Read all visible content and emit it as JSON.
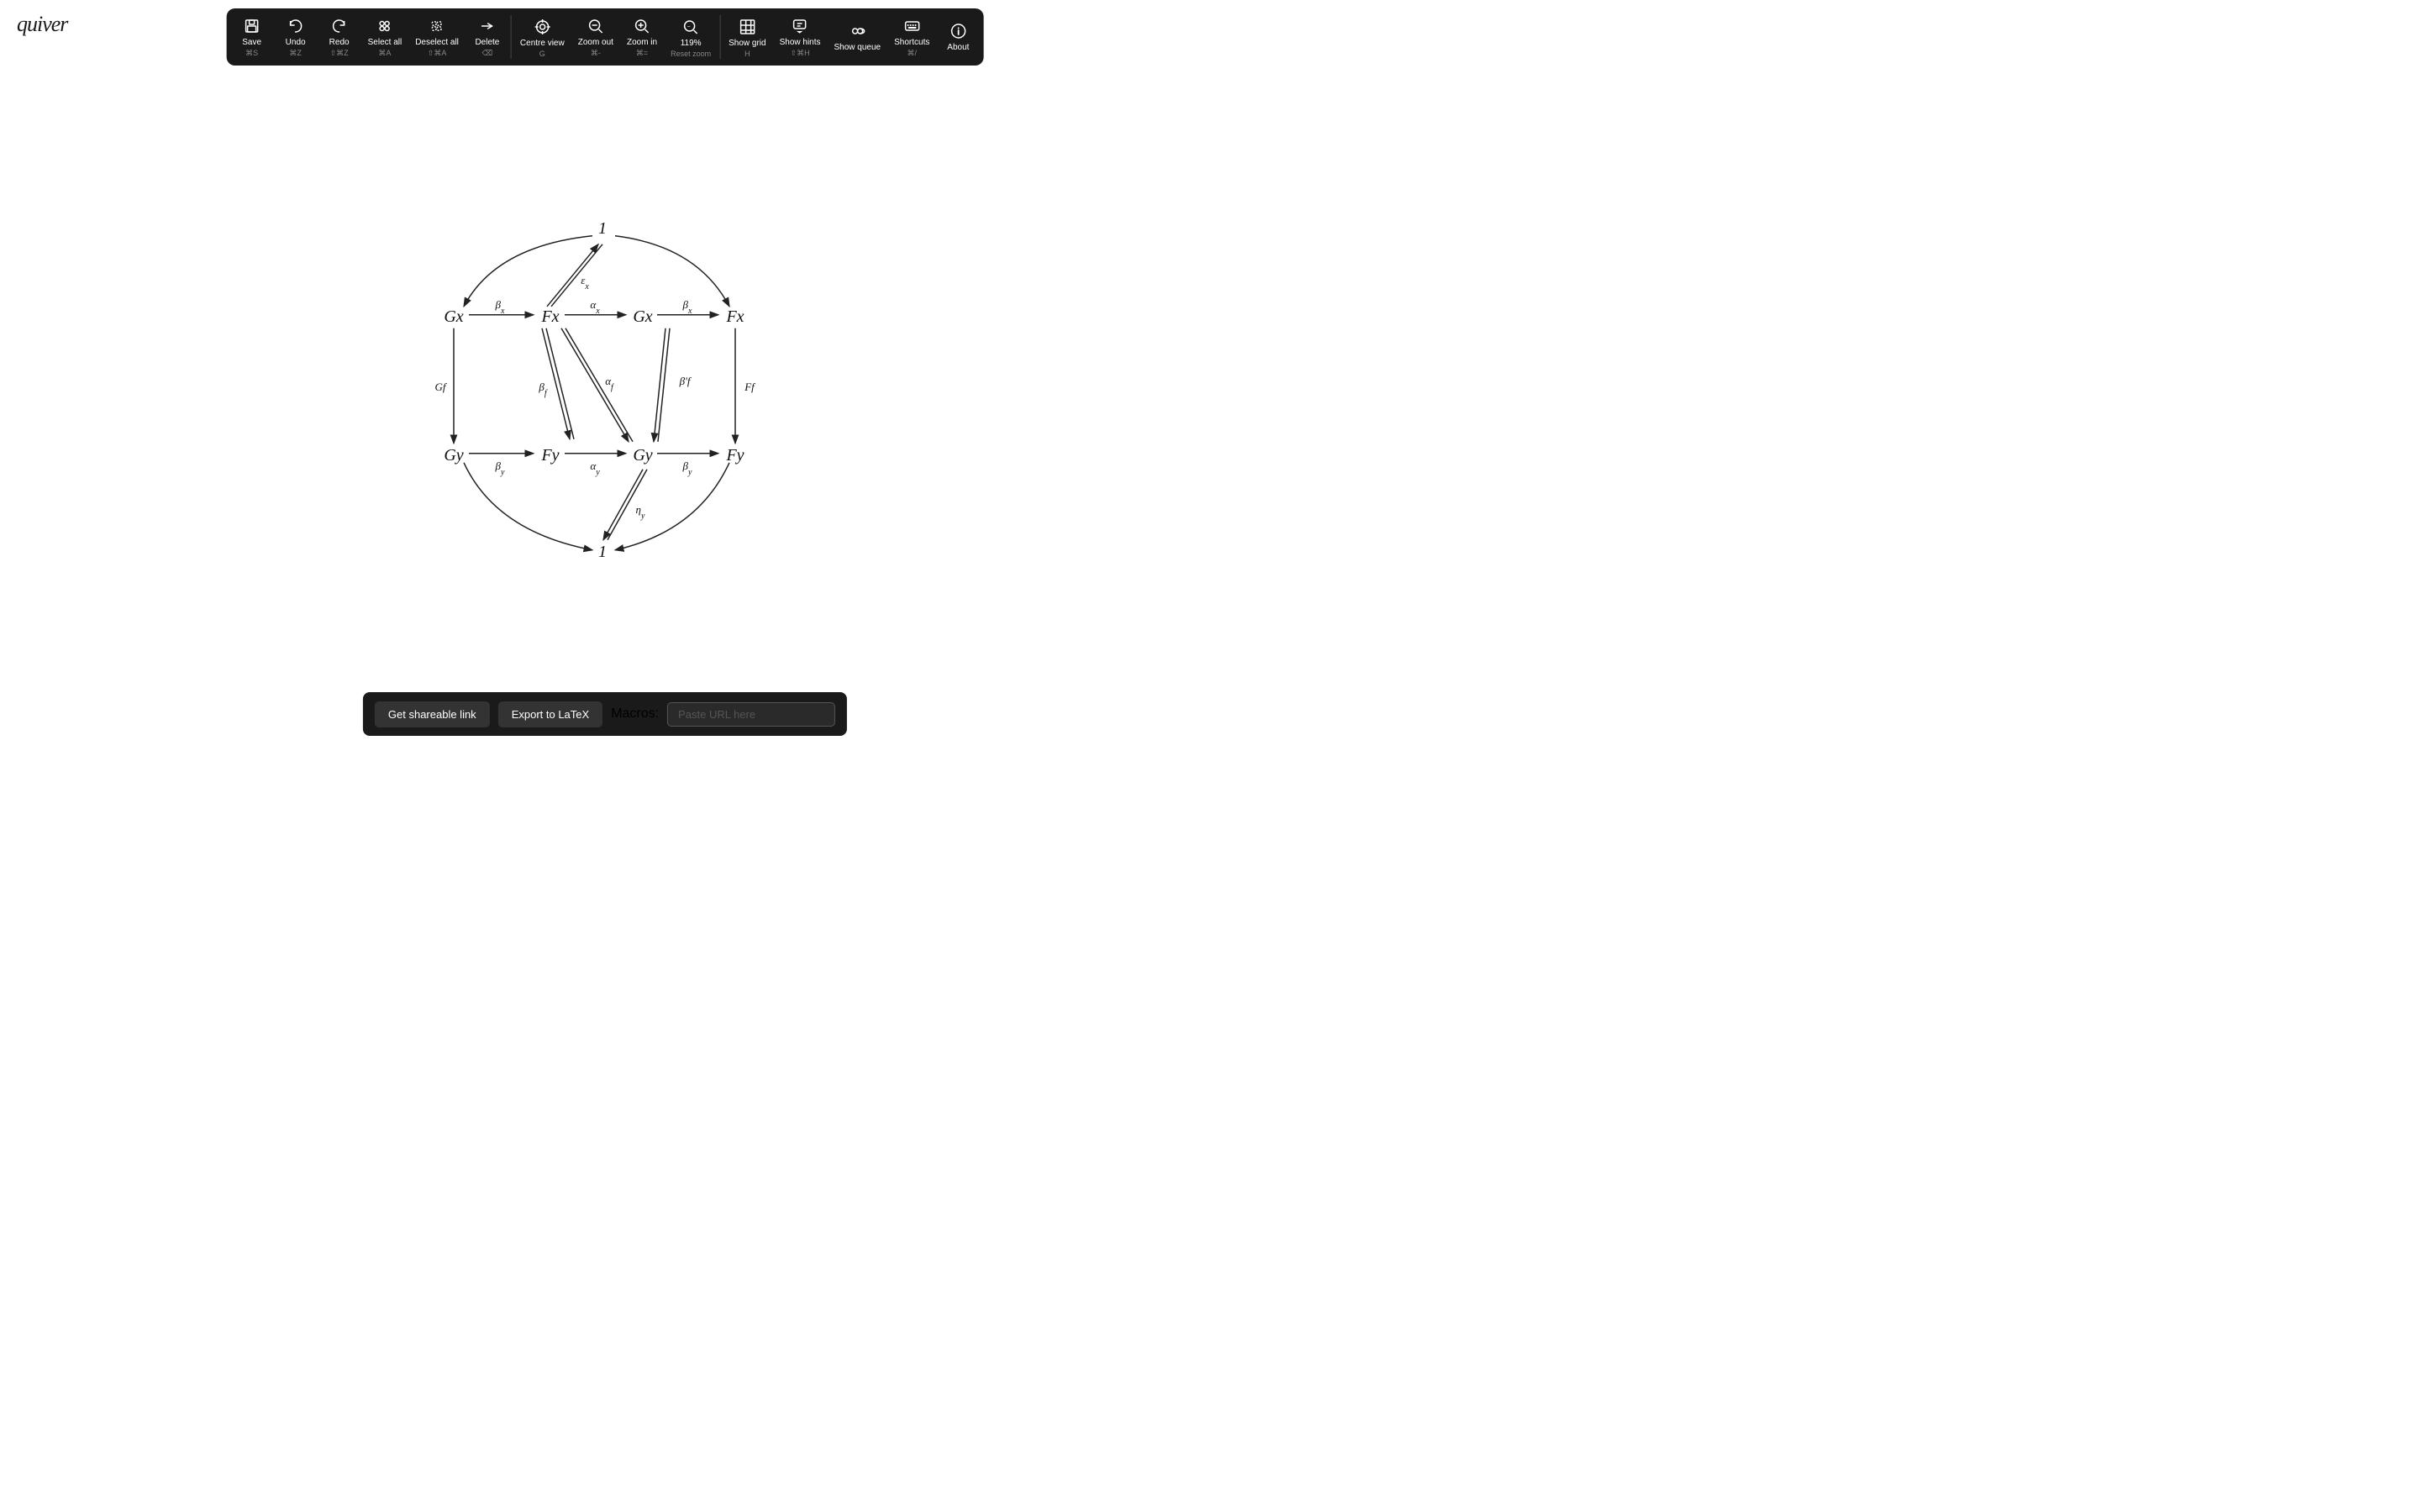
{
  "logo": {
    "text": "quiver"
  },
  "toolbar": {
    "items": [
      {
        "id": "save",
        "label": "Save",
        "shortcut": "⌘S",
        "icon": "url"
      },
      {
        "id": "undo",
        "label": "Undo",
        "shortcut": "⌘Z",
        "icon": "undo"
      },
      {
        "id": "redo",
        "label": "Redo",
        "shortcut": "⇧⌘Z",
        "icon": "redo"
      },
      {
        "id": "select-all",
        "label": "Select all",
        "shortcut": "⌘A",
        "icon": "select-all"
      },
      {
        "id": "deselect-all",
        "label": "Deselect all",
        "shortcut": "⇧⌘A",
        "icon": "deselect-all"
      },
      {
        "id": "delete",
        "label": "Delete",
        "shortcut": "⌫",
        "icon": "delete"
      },
      {
        "id": "centre-view",
        "label": "Centre view",
        "shortcut": "G",
        "icon": "centre"
      },
      {
        "id": "zoom-out",
        "label": "Zoom out",
        "shortcut": "⌘-",
        "icon": "zoom-out"
      },
      {
        "id": "zoom-in",
        "label": "Zoom in",
        "shortcut": "⌘=",
        "icon": "zoom-in"
      },
      {
        "id": "reset-zoom",
        "label": "Reset zoom",
        "shortcut": "",
        "value": "119%",
        "icon": "reset-zoom"
      },
      {
        "id": "show-grid",
        "label": "Show grid",
        "shortcut": "H",
        "icon": "grid"
      },
      {
        "id": "show-hints",
        "label": "Show hints",
        "shortcut": "⇧⌘H",
        "icon": "hints"
      },
      {
        "id": "show-queue",
        "label": "Show queue",
        "shortcut": "",
        "icon": "queue"
      },
      {
        "id": "shortcuts",
        "label": "Shortcuts",
        "shortcut": "⌘/",
        "icon": "keyboard"
      },
      {
        "id": "about",
        "label": "About",
        "shortcut": "",
        "icon": "info"
      }
    ]
  },
  "bottom_bar": {
    "shareable_label": "Get shareable link",
    "latex_label": "Export to LaTeX",
    "macros_label": "Macros:",
    "macros_placeholder": "Paste URL here"
  },
  "diagram": {
    "nodes": {
      "n1": "1",
      "gx1": "Gx",
      "fx1": "Fx",
      "gx2": "Gx",
      "fx2": "Fx",
      "gy1": "Gy",
      "fy1": "Fy",
      "gy2": "Gy",
      "fy2": "Fy",
      "n2": "1"
    },
    "arrows": {
      "beta_x1": "β_x",
      "alpha_x": "α_x",
      "beta_x2": "β_x",
      "eps_x": "ε_x",
      "gf": "Gf",
      "beta_f": "β_f",
      "alpha_f": "α_f",
      "beta_prime_f": "β'f",
      "ff": "Ff",
      "beta_y1": "β_y",
      "alpha_y": "α_y",
      "beta_y2": "β_y",
      "eta_y": "η_y"
    }
  }
}
